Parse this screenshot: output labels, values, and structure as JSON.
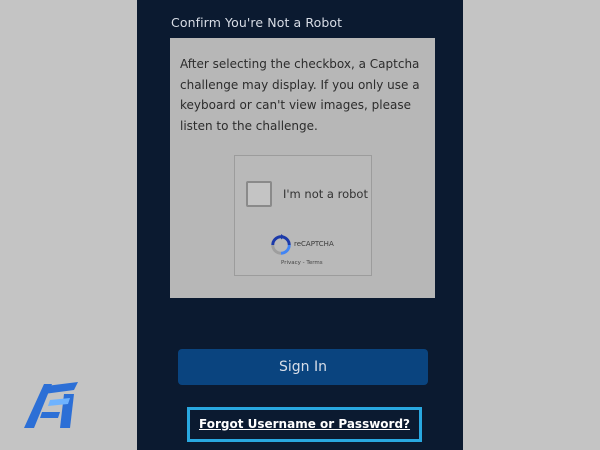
{
  "login": {
    "section_heading": "Confirm You're Not a Robot",
    "captcha_instructions": "After selecting the checkbox, a Captcha challenge may display. If you only use a keyboard or can't view images, please listen to the challenge.",
    "recaptcha": {
      "checkbox_label": "I'm not a robot",
      "checked": false,
      "brand": "reCAPTCHA",
      "links": "Privacy - Terms",
      "logo_icon": "recaptcha-logo-icon"
    },
    "signin_button": "Sign In",
    "forgot_link": "Forgot Username or Password?"
  },
  "watermark": {
    "logo_icon": "fa-watermark-logo"
  },
  "colors": {
    "page_background": "#c4c4c4",
    "panel_background": "#0b1a30",
    "signin_button": "#0a447f",
    "highlight_border": "#29a8e0"
  }
}
